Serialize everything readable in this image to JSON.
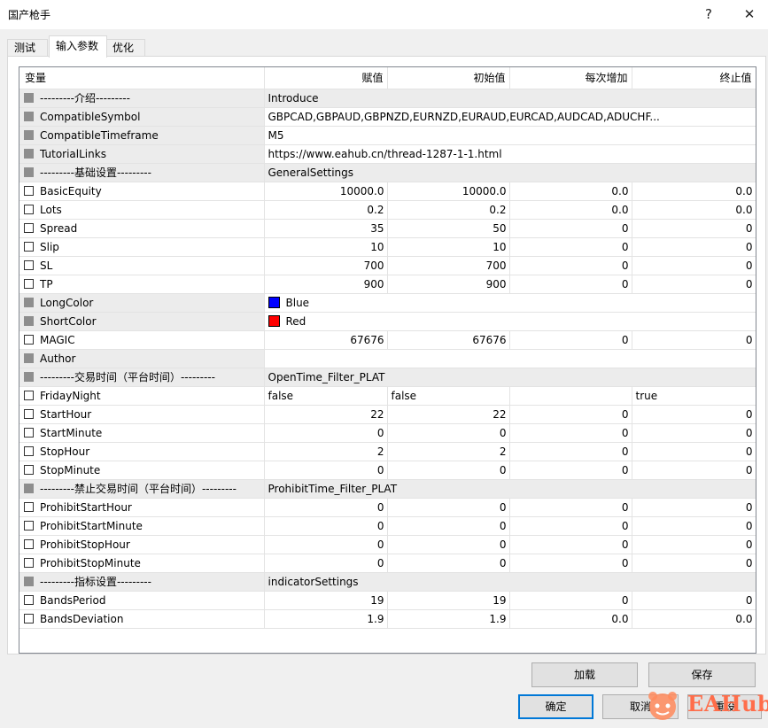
{
  "window": {
    "title": "国产枪手",
    "help_label": "?",
    "close_label": "✕"
  },
  "tabs": [
    {
      "label": "测试"
    },
    {
      "label": "输入参数"
    },
    {
      "label": "优化"
    }
  ],
  "grid": {
    "headers": [
      "变量",
      "赋值",
      "初始值",
      "每次增加",
      "终止值"
    ],
    "rows": [
      {
        "type": "section",
        "name": "---------介绍---------",
        "value": "Introduce"
      },
      {
        "type": "text",
        "name": "CompatibleSymbol",
        "value": "GBPCAD,GBPAUD,GBPNZD,EURNZD,EURAUD,EURCAD,AUDCAD,ADUCHF..."
      },
      {
        "type": "text",
        "name": "CompatibleTimeframe",
        "value": "M5"
      },
      {
        "type": "text",
        "name": "TutorialLinks",
        "value": "https://www.eahub.cn/thread-1287-1-1.html"
      },
      {
        "type": "section",
        "name": "---------基础设置---------",
        "value": "GeneralSettings"
      },
      {
        "type": "num",
        "name": "BasicEquity",
        "value": "10000.0",
        "start": "10000.0",
        "step": "0.0",
        "stop": "0.0"
      },
      {
        "type": "num",
        "name": "Lots",
        "value": "0.2",
        "start": "0.2",
        "step": "0.0",
        "stop": "0.0"
      },
      {
        "type": "num",
        "name": "Spread",
        "value": "35",
        "start": "50",
        "step": "0",
        "stop": "0"
      },
      {
        "type": "num",
        "name": "Slip",
        "value": "10",
        "start": "10",
        "step": "0",
        "stop": "0"
      },
      {
        "type": "num",
        "name": "SL",
        "value": "700",
        "start": "700",
        "step": "0",
        "stop": "0"
      },
      {
        "type": "num",
        "name": "TP",
        "value": "900",
        "start": "900",
        "step": "0",
        "stop": "0"
      },
      {
        "type": "color",
        "name": "LongColor",
        "value": "Blue",
        "color": "#0000ff"
      },
      {
        "type": "color",
        "name": "ShortColor",
        "value": "Red",
        "color": "#ff0000"
      },
      {
        "type": "num",
        "name": "MAGIC",
        "value": "67676",
        "start": "67676",
        "step": "0",
        "stop": "0"
      },
      {
        "type": "text",
        "name": "Author",
        "value": ""
      },
      {
        "type": "section",
        "name": "---------交易时间（平台时间）---------",
        "value": "OpenTime_Filter_PLAT"
      },
      {
        "type": "bool",
        "name": "FridayNight",
        "value": "false",
        "start": "false",
        "step": "",
        "stop": "true"
      },
      {
        "type": "num",
        "name": "StartHour",
        "value": "22",
        "start": "22",
        "step": "0",
        "stop": "0"
      },
      {
        "type": "num",
        "name": "StartMinute",
        "value": "0",
        "start": "0",
        "step": "0",
        "stop": "0"
      },
      {
        "type": "num",
        "name": "StopHour",
        "value": "2",
        "start": "2",
        "step": "0",
        "stop": "0"
      },
      {
        "type": "num",
        "name": "StopMinute",
        "value": "0",
        "start": "0",
        "step": "0",
        "stop": "0"
      },
      {
        "type": "section",
        "name": "---------禁止交易时间（平台时间）---------",
        "value": "ProhibitTime_Filter_PLAT"
      },
      {
        "type": "num",
        "name": "ProhibitStartHour",
        "value": "0",
        "start": "0",
        "step": "0",
        "stop": "0"
      },
      {
        "type": "num",
        "name": "ProhibitStartMinute",
        "value": "0",
        "start": "0",
        "step": "0",
        "stop": "0"
      },
      {
        "type": "num",
        "name": "ProhibitStopHour",
        "value": "0",
        "start": "0",
        "step": "0",
        "stop": "0"
      },
      {
        "type": "num",
        "name": "ProhibitStopMinute",
        "value": "0",
        "start": "0",
        "step": "0",
        "stop": "0"
      },
      {
        "type": "section",
        "name": "---------指标设置---------",
        "value": "indicatorSettings"
      },
      {
        "type": "num",
        "name": "BandsPeriod",
        "value": "19",
        "start": "19",
        "step": "0",
        "stop": "0"
      },
      {
        "type": "num",
        "name": "BandsDeviation",
        "value": "1.9",
        "start": "1.9",
        "step": "0.0",
        "stop": "0.0"
      }
    ]
  },
  "buttons": {
    "load": "加载",
    "save": "保存",
    "ok": "确定",
    "cancel": "取消",
    "reset": "重设"
  },
  "watermark": {
    "text": "EAHub"
  },
  "colors": {
    "accent": "#0078d7",
    "watermark": "#ff6d4a"
  }
}
